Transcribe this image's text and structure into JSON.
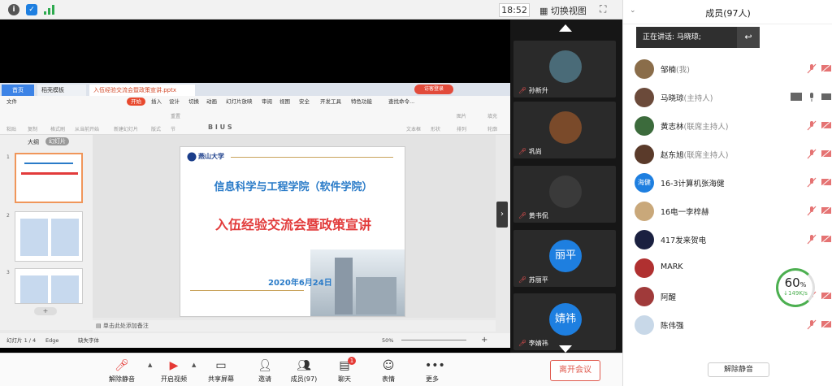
{
  "topbar": {
    "info_icon": "info-icon",
    "shield_icon": "shield-icon",
    "signal_icon": "signal-icon",
    "clock": "18:52",
    "switch_view_label": "切换视图"
  },
  "ppt": {
    "tabs": {
      "home": "首页",
      "template": "稻壳模板",
      "document": "入伍经验交流会暨政策宣讲.pptx"
    },
    "visitor": "访客登录",
    "menu": {
      "file": "文件",
      "start": "开始",
      "items": [
        "插入",
        "设计",
        "切换",
        "动画",
        "幻灯片放映",
        "审阅",
        "视图",
        "安全",
        "开发工具",
        "特色功能"
      ],
      "search": "查找命令..."
    },
    "ribbon": {
      "paste": "粘贴",
      "copy": "复制",
      "format_painter": "格式刷",
      "from_current": "从当前开始",
      "new_slide": "新建幻灯片",
      "layout": "版式",
      "section": "节",
      "reset": "重置",
      "textbox": "文本框",
      "shape": "形状",
      "picture": "图片",
      "fill": "填充",
      "arrange": "排列",
      "outline": "轮廓"
    },
    "left_tabs": {
      "outline": "大纲",
      "slides": "幻灯片"
    },
    "thumbnails": [
      "1",
      "2",
      "3"
    ],
    "slide": {
      "logo": "燕山大学",
      "title": "信息科学与工程学院（软件学院）",
      "subtitle": "入伍经验交流会暨政策宣讲",
      "date": "2020年6月24日"
    },
    "notes_placeholder": "单击此处添加备注",
    "status": {
      "slide_count": "幻灯片 1 / 4",
      "theme": "Edge",
      "font_missing": "缺失字体",
      "zoom": "50%"
    }
  },
  "video_tiles": [
    {
      "name": "孙新升",
      "avatar_color": "#4a6b78"
    },
    {
      "name": "巩尚",
      "avatar_color": "#7a4a2a"
    },
    {
      "name": "黄书侃",
      "avatar_color": "#3a3a3a"
    },
    {
      "name": "苏丽平",
      "avatar_text": "丽平",
      "avatar_color": "#1e7fe0"
    },
    {
      "name": "李婧祎",
      "avatar_text": "婧祎",
      "avatar_color": "#1e7fe0"
    }
  ],
  "toolbar": {
    "unmute": "解除静音",
    "video": "开启视频",
    "share": "共享屏幕",
    "invite": "邀请",
    "members": "成员(97)",
    "chat": "聊天",
    "chat_badge": "1",
    "emoji": "表情",
    "more": "更多",
    "leave": "离开会议"
  },
  "panel": {
    "title": "成员(97人)",
    "speaking": "正在讲话: 马晓琼;",
    "members": [
      {
        "name": "邹楠",
        "role": "(我)",
        "avatar_color": "#8a6d4a"
      },
      {
        "name": "马晓琼",
        "role": "(主持人)",
        "avatar_color": "#6b4a3a"
      },
      {
        "name": "黄志林",
        "role": "(联席主持人)",
        "avatar_color": "#3c6b3c"
      },
      {
        "name": "赵东旭",
        "role": "(联席主持人)",
        "avatar_color": "#5a3a2a"
      },
      {
        "name": "16-3计算机张海健",
        "role": "",
        "avatar_text": "海健",
        "avatar_color": "#1e7fe0"
      },
      {
        "name": "16电一李梓赫",
        "role": "",
        "avatar_color": "#c9a87a"
      },
      {
        "name": "417发来贺电",
        "role": "",
        "avatar_color": "#1a2040"
      },
      {
        "name": "MARK",
        "role": "",
        "avatar_color": "#b03030"
      },
      {
        "name": "阿醒",
        "role": "",
        "avatar_color": "#a03a3a"
      },
      {
        "name": "陈伟强",
        "role": "",
        "avatar_color": "#c8d8e8"
      }
    ],
    "network_pct": "60",
    "network_unit": "%",
    "network_speed": "149K/s",
    "unmute_all": "解除静音"
  },
  "colors": {
    "accent": "#1e7fe0",
    "danger": "#e05a4e",
    "slide_blue": "#2a7bc8",
    "slide_red": "#e23b3b"
  }
}
